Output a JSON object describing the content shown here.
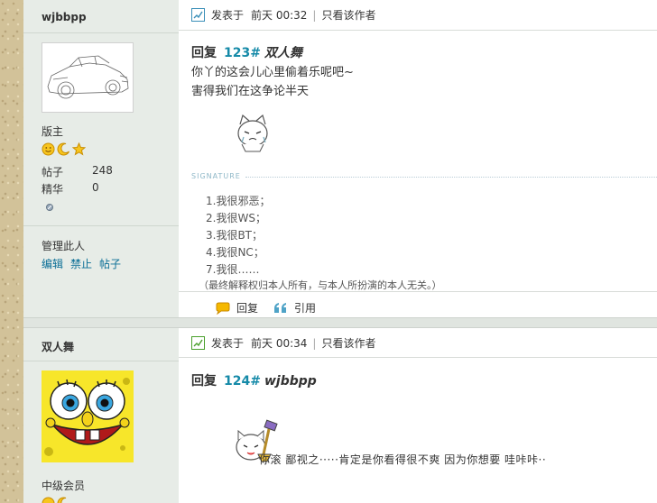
{
  "post1": {
    "author": {
      "username": "wjbbpp",
      "rank": "版主",
      "stats": [
        {
          "label": "帖子",
          "value": "248"
        },
        {
          "label": "精华",
          "value": "0"
        }
      ],
      "admin_title": "管理此人",
      "admin_links": [
        "编辑",
        "禁止",
        "帖子"
      ]
    },
    "header": {
      "posted_label": "发表于",
      "time": "前天 00:32",
      "author_only_link": "只看该作者"
    },
    "reply": {
      "prefix": "回复",
      "floor": "123#",
      "to": "双人舞"
    },
    "message": [
      "你丫的这会儿心里偷着乐呢吧~",
      "害得我们在这争论半天"
    ],
    "signature": {
      "label": "SIGNATURE",
      "lines": [
        "1.我很邪恶；",
        "2.我很WS；",
        "3.我很BT；",
        "4.我很NC；",
        "7.我很……",
        "（最终解释权归本人所有，与本人所扮演的本人无关。）"
      ]
    },
    "actions": {
      "reply": "回复",
      "quote": "引用"
    }
  },
  "post2": {
    "author": {
      "username": "双人舞",
      "rank": "中级会员"
    },
    "header": {
      "posted_label": "发表于",
      "time": "前天 00:34",
      "author_only_link": "只看该作者"
    },
    "reply": {
      "prefix": "回复",
      "floor": "124#",
      "to": "wjbbpp"
    },
    "message": "你滚  鄙视之·····肯定是你看得很不爽 因为你想要 哇咔咔··"
  },
  "colors": {
    "link": "#0a6e96",
    "floor": "#158aa8",
    "sidebar_bg": "#e7ece7",
    "page_border": "#d2c299"
  },
  "icons": [
    "post-icon",
    "smiley-icon",
    "moon-icon",
    "star-icon",
    "online-status-icon",
    "reply-bubble-icon",
    "quote-icon"
  ]
}
